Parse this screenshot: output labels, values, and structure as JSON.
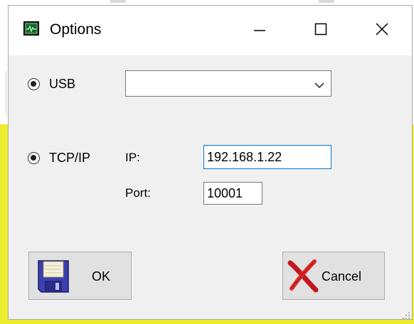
{
  "window": {
    "title": "Options",
    "controls": {
      "minimize_icon": "minimize-icon",
      "maximize_icon": "maximize-icon",
      "close_icon": "close-icon"
    }
  },
  "connection": {
    "usb": {
      "label": "USB",
      "selected_device": ""
    },
    "tcp": {
      "label": "TCP/IP",
      "ip_label": "IP:",
      "ip_value": "192.168.1.22",
      "port_label": "Port:",
      "port_value": "10001"
    }
  },
  "actions": {
    "ok_label": "OK",
    "cancel_label": "Cancel",
    "ok_icon": "floppy-disk-icon",
    "cancel_icon": "red-x-icon"
  },
  "colors": {
    "focus_border": "#0078d7",
    "dialog_background": "#f0f0f0",
    "button_background": "#e1e1e1",
    "backdrop_yellow": "#eeec2e"
  }
}
